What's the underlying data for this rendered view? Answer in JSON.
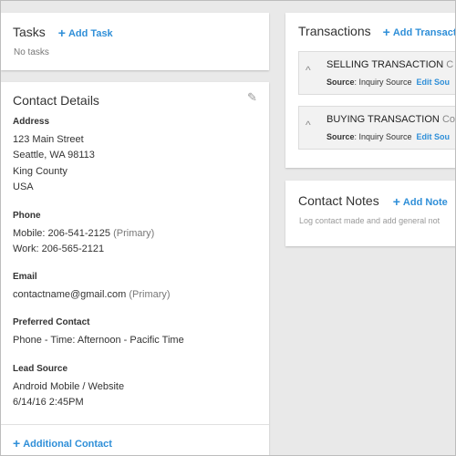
{
  "tasks": {
    "title": "Tasks",
    "add_label": "Add Task",
    "empty_text": "No tasks"
  },
  "contact": {
    "title": "Contact Details",
    "address_label": "Address",
    "address_lines": [
      "123 Main Street",
      "Seattle, WA 98113",
      "King County",
      "USA"
    ],
    "phone_label": "Phone",
    "phone_mobile": "Mobile: 206-541-2125",
    "phone_mobile_tag": "(Primary)",
    "phone_work": "Work: 206-565-2121",
    "email_label": "Email",
    "email_value": "contactname@gmail.com",
    "email_tag": "(Primary)",
    "preferred_label": "Preferred Contact",
    "preferred_value": "Phone - Time: Afternoon - Pacific Time",
    "lead_label": "Lead Source",
    "lead_value": "Android Mobile / Website",
    "lead_time": "6/14/16 2:45PM",
    "additional_label": "Additional Contact"
  },
  "transactions": {
    "title": "Transactions",
    "add_label": "Add Transaction",
    "items": [
      {
        "name": "SELLING TRANSACTION",
        "name_extra": "C",
        "source_label": "Source",
        "source_value": ": Inquiry Source",
        "edit_label": "Edit Sou"
      },
      {
        "name": "BUYING TRANSACTION",
        "name_extra": "Co",
        "source_label": "Source",
        "source_value": ": Inquiry Source",
        "edit_label": "Edit Sou"
      }
    ]
  },
  "notes": {
    "title": "Contact Notes",
    "add_label": "Add Note",
    "description": "Log contact made and add general not"
  },
  "icons": {
    "plus": "+",
    "pencil": "✎",
    "chevron": "^"
  },
  "colors": {
    "accent": "#2f8fd8",
    "background": "#e9e9e9"
  }
}
